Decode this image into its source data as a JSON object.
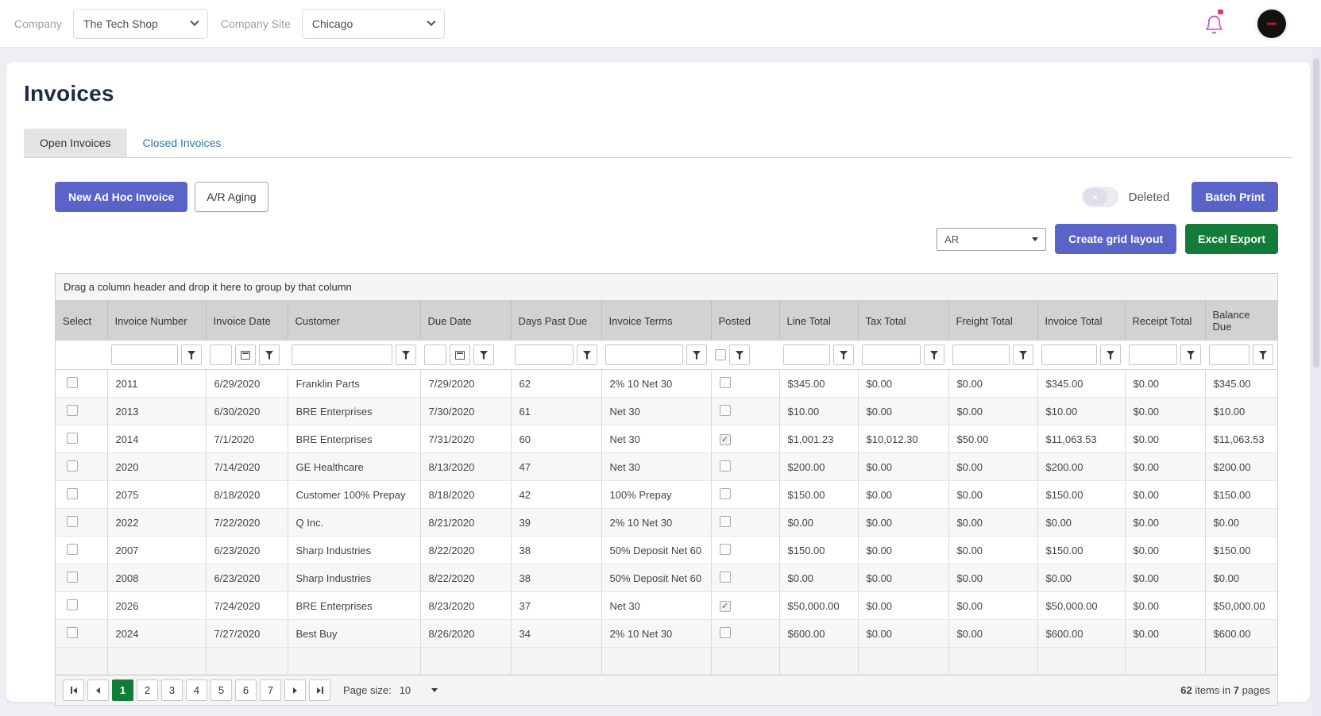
{
  "colors": {
    "primary": "#5a63c8",
    "green": "#127c38",
    "pager_active": "#127c38",
    "link": "#3276b1",
    "badge_red": "#e8384f"
  },
  "topbar": {
    "company_label": "Company",
    "company_value": "The Tech Shop",
    "site_label": "Company Site",
    "site_value": "Chicago"
  },
  "page": {
    "title": "Invoices"
  },
  "tabs": [
    {
      "label": "Open Invoices",
      "active": true
    },
    {
      "label": "Closed Invoices",
      "active": false
    }
  ],
  "toolbar": {
    "new_ad_hoc_label": "New Ad Hoc Invoice",
    "ar_aging_label": "A/R Aging",
    "deleted_toggle_glyph": "×",
    "deleted_label": "Deleted",
    "batch_print_label": "Batch Print",
    "layout_select_value": "AR",
    "create_grid_layout_label": "Create grid layout",
    "excel_export_label": "Excel Export"
  },
  "grid": {
    "group_hint": "Drag a column header and drop it here to group by that column",
    "columns": [
      {
        "label": "Select",
        "filter": "none"
      },
      {
        "label": "Invoice Number",
        "filter": "text"
      },
      {
        "label": "Invoice Date",
        "filter": "date"
      },
      {
        "label": "Customer",
        "filter": "text"
      },
      {
        "label": "Due Date",
        "filter": "date"
      },
      {
        "label": "Days Past Due",
        "filter": "text"
      },
      {
        "label": "Invoice Terms",
        "filter": "text"
      },
      {
        "label": "Posted",
        "filter": "checkbox"
      },
      {
        "label": "Line Total",
        "filter": "text"
      },
      {
        "label": "Tax Total",
        "filter": "text"
      },
      {
        "label": "Freight Total",
        "filter": "text"
      },
      {
        "label": "Invoice Total",
        "filter": "text"
      },
      {
        "label": "Receipt Total",
        "filter": "text"
      },
      {
        "label": "Balance Due",
        "filter": "text"
      }
    ],
    "rows": [
      {
        "selected": false,
        "invoice_number": "2011",
        "invoice_date": "6/29/2020",
        "customer": "Franklin Parts",
        "due_date": "7/29/2020",
        "days_past_due": "62",
        "invoice_terms": "2% 10 Net 30",
        "posted": false,
        "line_total": "$345.00",
        "tax_total": "$0.00",
        "freight_total": "$0.00",
        "invoice_total": "$345.00",
        "receipt_total": "$0.00",
        "balance_due": "$345.00"
      },
      {
        "selected": false,
        "invoice_number": "2013",
        "invoice_date": "6/30/2020",
        "customer": "BRE Enterprises",
        "due_date": "7/30/2020",
        "days_past_due": "61",
        "invoice_terms": "Net 30",
        "posted": false,
        "line_total": "$10.00",
        "tax_total": "$0.00",
        "freight_total": "$0.00",
        "invoice_total": "$10.00",
        "receipt_total": "$0.00",
        "balance_due": "$10.00"
      },
      {
        "selected": false,
        "invoice_number": "2014",
        "invoice_date": "7/1/2020",
        "customer": "BRE Enterprises",
        "due_date": "7/31/2020",
        "days_past_due": "60",
        "invoice_terms": "Net 30",
        "posted": true,
        "line_total": "$1,001.23",
        "tax_total": "$10,012.30",
        "freight_total": "$50.00",
        "invoice_total": "$11,063.53",
        "receipt_total": "$0.00",
        "balance_due": "$11,063.53"
      },
      {
        "selected": false,
        "invoice_number": "2020",
        "invoice_date": "7/14/2020",
        "customer": "GE Healthcare",
        "due_date": "8/13/2020",
        "days_past_due": "47",
        "invoice_terms": "Net 30",
        "posted": false,
        "line_total": "$200.00",
        "tax_total": "$0.00",
        "freight_total": "$0.00",
        "invoice_total": "$200.00",
        "receipt_total": "$0.00",
        "balance_due": "$200.00"
      },
      {
        "selected": false,
        "invoice_number": "2075",
        "invoice_date": "8/18/2020",
        "customer": "Customer 100% Prepay",
        "due_date": "8/18/2020",
        "days_past_due": "42",
        "invoice_terms": "100% Prepay",
        "posted": false,
        "line_total": "$150.00",
        "tax_total": "$0.00",
        "freight_total": "$0.00",
        "invoice_total": "$150.00",
        "receipt_total": "$0.00",
        "balance_due": "$150.00"
      },
      {
        "selected": false,
        "invoice_number": "2022",
        "invoice_date": "7/22/2020",
        "customer": "Q Inc.",
        "due_date": "8/21/2020",
        "days_past_due": "39",
        "invoice_terms": "2% 10 Net 30",
        "posted": false,
        "line_total": "$0.00",
        "tax_total": "$0.00",
        "freight_total": "$0.00",
        "invoice_total": "$0.00",
        "receipt_total": "$0.00",
        "balance_due": "$0.00"
      },
      {
        "selected": false,
        "invoice_number": "2007",
        "invoice_date": "6/23/2020",
        "customer": "Sharp Industries",
        "due_date": "8/22/2020",
        "days_past_due": "38",
        "invoice_terms": "50% Deposit Net 60",
        "posted": false,
        "line_total": "$150.00",
        "tax_total": "$0.00",
        "freight_total": "$0.00",
        "invoice_total": "$150.00",
        "receipt_total": "$0.00",
        "balance_due": "$150.00"
      },
      {
        "selected": false,
        "invoice_number": "2008",
        "invoice_date": "6/23/2020",
        "customer": "Sharp Industries",
        "due_date": "8/22/2020",
        "days_past_due": "38",
        "invoice_terms": "50% Deposit Net 60",
        "posted": false,
        "line_total": "$0.00",
        "tax_total": "$0.00",
        "freight_total": "$0.00",
        "invoice_total": "$0.00",
        "receipt_total": "$0.00",
        "balance_due": "$0.00"
      },
      {
        "selected": false,
        "invoice_number": "2026",
        "invoice_date": "7/24/2020",
        "customer": "BRE Enterprises",
        "due_date": "8/23/2020",
        "days_past_due": "37",
        "invoice_terms": "Net 30",
        "posted": true,
        "line_total": "$50,000.00",
        "tax_total": "$0.00",
        "freight_total": "$0.00",
        "invoice_total": "$50,000.00",
        "receipt_total": "$0.00",
        "balance_due": "$50,000.00"
      },
      {
        "selected": false,
        "invoice_number": "2024",
        "invoice_date": "7/27/2020",
        "customer": "Best Buy",
        "due_date": "8/26/2020",
        "days_past_due": "34",
        "invoice_terms": "2% 10 Net 30",
        "posted": false,
        "line_total": "$600.00",
        "tax_total": "$0.00",
        "freight_total": "$0.00",
        "invoice_total": "$600.00",
        "receipt_total": "$0.00",
        "balance_due": "$600.00"
      }
    ]
  },
  "pager": {
    "pages": [
      "1",
      "2",
      "3",
      "4",
      "5",
      "6",
      "7"
    ],
    "active_page": "1",
    "page_size_label": "Page size:",
    "page_size_value": "10",
    "items_count": "62",
    "items_text": " items in ",
    "pages_count": "7",
    "pages_text": " pages"
  }
}
